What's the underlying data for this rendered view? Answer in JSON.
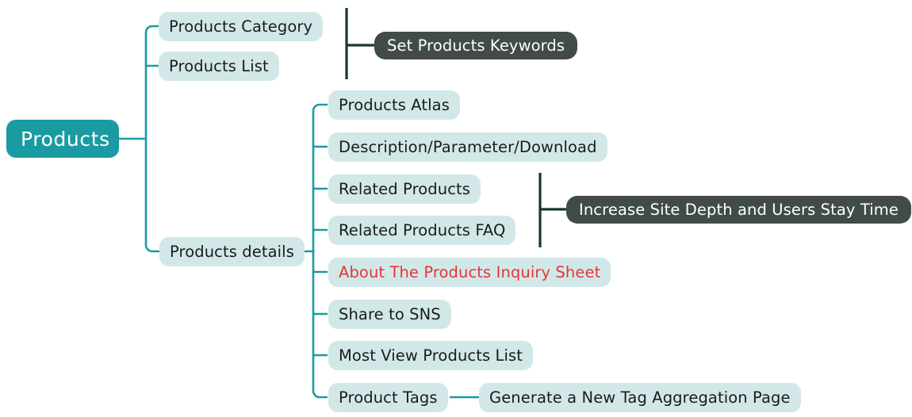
{
  "diagram": {
    "type": "mindmap",
    "title": "Products",
    "orientation": "left-to-right",
    "colors": {
      "root_fill": "#1a9ba1",
      "root_text": "#ffffff",
      "node_fill": "#d2e8e8",
      "node_text": "#1b1b1b",
      "highlight_text": "#e8333a",
      "annotation_fill": "#414b47",
      "annotation_text": "#ffffff",
      "connector": "#1a9ba1",
      "bracket": "#163733",
      "background": "#ffffff"
    },
    "root": {
      "label": "Products"
    },
    "branches": [
      {
        "label": "Products Category"
      },
      {
        "label": "Products List"
      },
      {
        "label": "Products details"
      }
    ],
    "details_children": [
      {
        "label": "Products Atlas",
        "highlight": false
      },
      {
        "label": "Description/Parameter/Download",
        "highlight": false
      },
      {
        "label": "Related Products",
        "highlight": false
      },
      {
        "label": "Related Products FAQ",
        "highlight": false
      },
      {
        "label": "About The Products Inquiry Sheet",
        "highlight": true
      },
      {
        "label": "Share to SNS",
        "highlight": false
      },
      {
        "label": "Most View Products List",
        "highlight": false
      },
      {
        "label": "Product Tags",
        "highlight": false
      }
    ],
    "annotations": [
      {
        "label": "Set Products Keywords",
        "note": "bracket annotation spanning Products Category and Products List"
      },
      {
        "label": "Increase Site Depth and Users Stay Time",
        "note": "bracket annotation spanning Related Products through Related Products FAQ"
      }
    ],
    "leaf_nodes": [
      {
        "label": "Generate a New Tag Aggregation Page",
        "parent": "Product Tags"
      }
    ]
  }
}
